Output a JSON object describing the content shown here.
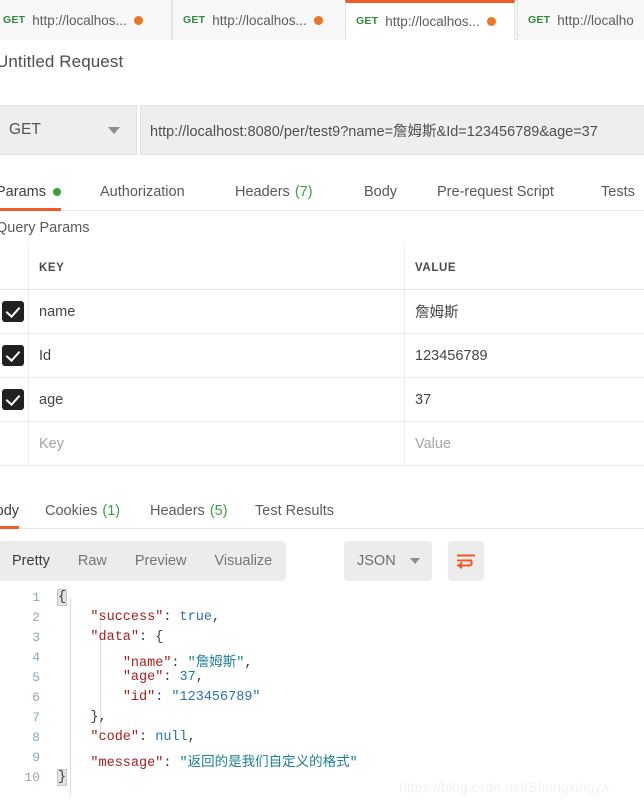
{
  "request_tabs": [
    {
      "method": "GET",
      "url": "http://localhos...",
      "unsaved": true,
      "active": false
    },
    {
      "method": "GET",
      "url": "http://localhos...",
      "unsaved": true,
      "active": false
    },
    {
      "method": "GET",
      "url": "http://localhos...",
      "unsaved": true,
      "active": true
    },
    {
      "method": "GET",
      "url": "http://localho",
      "unsaved": false,
      "active": false
    }
  ],
  "request": {
    "title": "Untitled Request",
    "method": "GET",
    "url": "http://localhost:8080/per/test9?name=詹姆斯&Id=123456789&age=37"
  },
  "request_subtabs": [
    {
      "label": "Params",
      "badge": "",
      "dot": true,
      "active": true
    },
    {
      "label": "Authorization",
      "badge": "",
      "dot": false,
      "active": false
    },
    {
      "label": "Headers",
      "badge": "(7)",
      "dot": false,
      "active": false
    },
    {
      "label": "Body",
      "badge": "",
      "dot": false,
      "active": false
    },
    {
      "label": "Pre-request Script",
      "badge": "",
      "dot": false,
      "active": false
    },
    {
      "label": "Tests",
      "badge": "",
      "dot": false,
      "active": false
    }
  ],
  "query_params": {
    "section_label": "Query Params",
    "columns": {
      "key": "KEY",
      "value": "VALUE"
    },
    "rows": [
      {
        "checked": true,
        "key": "name",
        "value": "詹姆斯",
        "placeholder": false
      },
      {
        "checked": true,
        "key": "Id",
        "value": "123456789",
        "placeholder": false
      },
      {
        "checked": true,
        "key": "age",
        "value": "37",
        "placeholder": false
      },
      {
        "checked": false,
        "key": "Key",
        "value": "Value",
        "placeholder": true
      }
    ]
  },
  "response_tabs": [
    {
      "label": "Body",
      "badge": "",
      "active": true
    },
    {
      "label": "Cookies",
      "badge": "(1)",
      "active": false
    },
    {
      "label": "Headers",
      "badge": "(5)",
      "active": false
    },
    {
      "label": "Test Results",
      "badge": "",
      "active": false
    }
  ],
  "format_bar": {
    "views": [
      {
        "label": "Pretty",
        "active": true
      },
      {
        "label": "Raw",
        "active": false
      },
      {
        "label": "Preview",
        "active": false
      },
      {
        "label": "Visualize",
        "active": false
      }
    ],
    "language": "JSON",
    "wrap_icon": "word-wrap-icon"
  },
  "response_body": {
    "line_numbers": [
      "1",
      "2",
      "3",
      "4",
      "5",
      "6",
      "7",
      "8",
      "9",
      "10"
    ],
    "lines": [
      [
        {
          "t": "{",
          "c": "brace1"
        }
      ],
      [
        {
          "t": "    ",
          "c": "p"
        },
        {
          "t": "\"success\"",
          "c": "k"
        },
        {
          "t": ": ",
          "c": "p"
        },
        {
          "t": "true",
          "c": "b"
        },
        {
          "t": ",",
          "c": "p"
        }
      ],
      [
        {
          "t": "    ",
          "c": "p"
        },
        {
          "t": "\"data\"",
          "c": "k"
        },
        {
          "t": ": {",
          "c": "p"
        }
      ],
      [
        {
          "t": "        ",
          "c": "p"
        },
        {
          "t": "\"name\"",
          "c": "k"
        },
        {
          "t": ": ",
          "c": "p"
        },
        {
          "t": "\"詹姆斯\"",
          "c": "s"
        },
        {
          "t": ",",
          "c": "p"
        }
      ],
      [
        {
          "t": "        ",
          "c": "p"
        },
        {
          "t": "\"age\"",
          "c": "k"
        },
        {
          "t": ": ",
          "c": "p"
        },
        {
          "t": "37",
          "c": "n"
        },
        {
          "t": ",",
          "c": "p"
        }
      ],
      [
        {
          "t": "        ",
          "c": "p"
        },
        {
          "t": "\"id\"",
          "c": "k"
        },
        {
          "t": ": ",
          "c": "p"
        },
        {
          "t": "\"123456789\"",
          "c": "b"
        }
      ],
      [
        {
          "t": "    },",
          "c": "p"
        }
      ],
      [
        {
          "t": "    ",
          "c": "p"
        },
        {
          "t": "\"code\"",
          "c": "k"
        },
        {
          "t": ": ",
          "c": "p"
        },
        {
          "t": "null",
          "c": "b"
        },
        {
          "t": ",",
          "c": "p"
        }
      ],
      [
        {
          "t": "    ",
          "c": "p"
        },
        {
          "t": "\"message\"",
          "c": "k"
        },
        {
          "t": ": ",
          "c": "p"
        },
        {
          "t": "\"返回的是我们自定义的格式\"",
          "c": "s"
        }
      ],
      [
        {
          "t": "}",
          "c": "brace2"
        }
      ]
    ]
  },
  "watermark": "https://blog.csdn.net/Shangxingya",
  "colors": {
    "accent": "#ef5b25",
    "method_get": "#2e8b3d",
    "unsaved_dot": "#ef7324",
    "badge_green": "#3a9e4a",
    "json_key": "#a71d1d",
    "json_string": "#1a7f8e",
    "json_literal": "#2f6fb5"
  }
}
